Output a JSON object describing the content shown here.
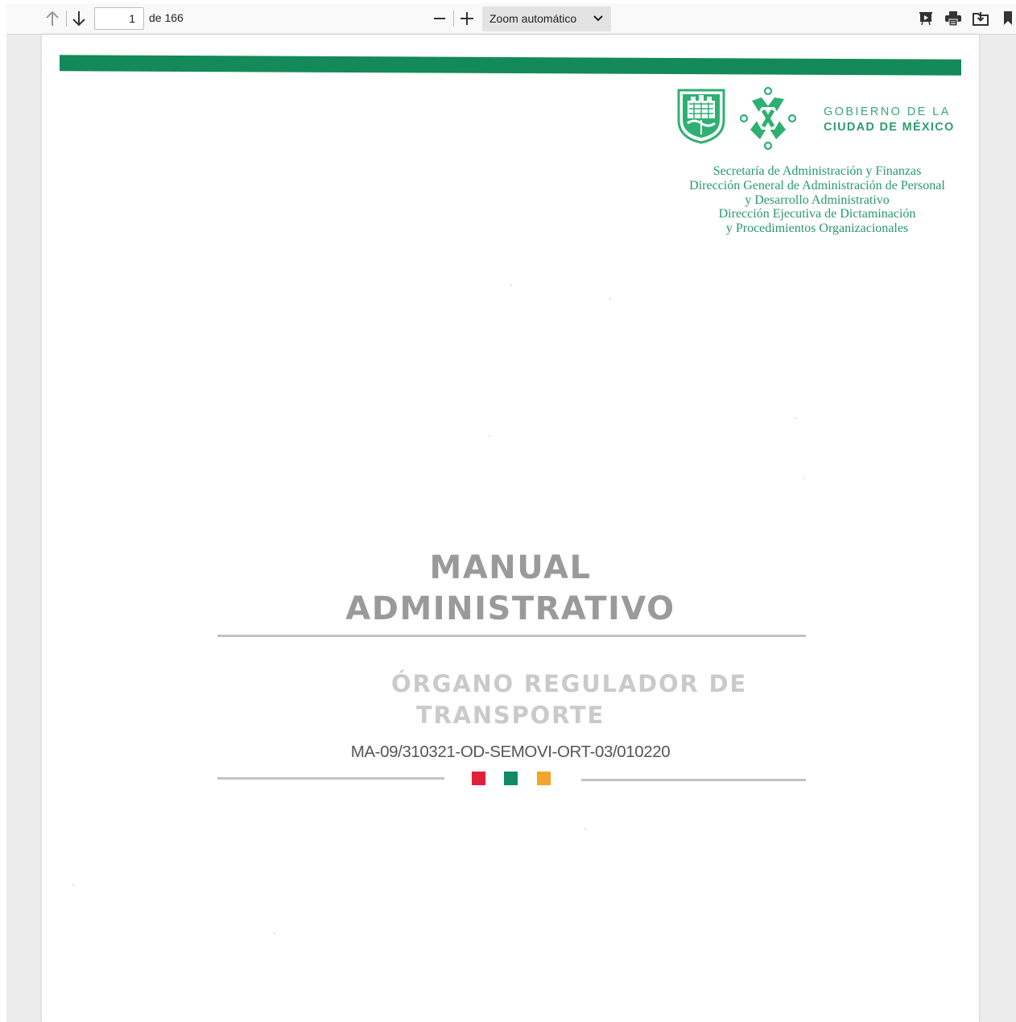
{
  "toolbar": {
    "page_input_value": "1",
    "page_count_label": "de 166",
    "zoom_selected": "Zoom automático",
    "icons": [
      "arrow-up-icon",
      "arrow-down-icon",
      "zoom-out-icon",
      "zoom-in-icon",
      "presentation-icon",
      "print-icon",
      "save-icon",
      "bookmark-icon"
    ]
  },
  "document": {
    "government_line1": "GOBIERNO DE LA",
    "government_line2": "CIUDAD DE MÉXICO",
    "department_lines": [
      "Secretaría  de Administración  y Finanzas",
      "Dirección General de Administración de Personal",
      "y Desarrollo Administrativo",
      "Dirección Ejecutiva de Dictaminación",
      "y Procedimientos Organizacionales"
    ],
    "title_line1": "MANUAL",
    "title_line2": "ADMINISTRATIVO",
    "subtitle_line1": "ÓRGANO REGULADOR DE",
    "subtitle_line2": "TRANSPORTE",
    "code": "MA-09/310321-OD-SEMOVI-ORT-03/010220"
  },
  "colors": {
    "brand_green": "#138a58",
    "logo_green": "#2fb072",
    "square_red": "#e0203a",
    "square_green": "#118a66",
    "square_orange": "#f3a42a"
  }
}
